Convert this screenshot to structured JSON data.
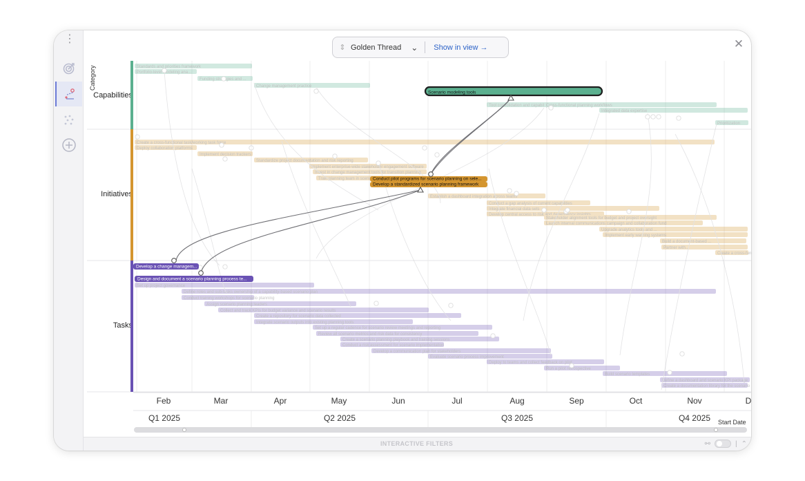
{
  "toolbar": {
    "view_name": "Golden Thread",
    "show_in_view": "Show in view"
  },
  "lanes": {
    "category_header": "Category",
    "capabilities": "Capabilities",
    "initiatives": "Initiatives",
    "tasks": "Tasks"
  },
  "colors": {
    "capabilities": "#5bb08f",
    "initiatives": "#d4952f",
    "tasks": "#6a52b4"
  },
  "axis": {
    "months": [
      "Feb",
      "Mar",
      "Apr",
      "May",
      "Jun",
      "Jul",
      "Aug",
      "Sep",
      "Oct",
      "Nov",
      "D"
    ],
    "quarters": [
      "Q1 2025",
      "Q2 2025",
      "Q3 2025",
      "Q4 2025"
    ],
    "field": "Start Date"
  },
  "highlighted": {
    "capability": "Scenario modeling tools",
    "initiative_1": "Conduct pilot programs for scenario planning on sele...",
    "initiative_2": "Develop a standardized scenario planning framework",
    "task_1": "Develop a change managem...",
    "task_2": "Design and document a scenario planning process te..."
  },
  "faded": {
    "capabilities": [
      "Standards and priorities framework",
      "Portfolio-level modeling ana...",
      "Funding strategies and ...",
      "Change management practice",
      "Tool consolidation and capability libraries",
      "Cross-functional planning workflows",
      "Integrated data expertise",
      "Prioritization"
    ],
    "initiatives": [
      "Create a cross-functional task/working task force",
      "Deploy collaboration platforms",
      "Implement decision trackers",
      "Standardize project documentation and risk reporting",
      "Implement enterprise-wide stakeholder engagement software",
      "Invest in change management tools for transition planning",
      "Train planning team in scenario analysis tools",
      "Establish a dashboard integration across teams",
      "Conduct a gap analysis of current capabilities",
      "Integrate financial data sets",
      "Develop central access to risk and dependency insights",
      "Stakeholder alignment tools for budget and project oversight",
      "Launch internal communications campaign and collaboration fund",
      "Upgrade analytics tools and ...",
      "Implement early warning systems",
      "Build a document-based ...",
      "Partner with..."
    ],
    "tasks": [
      "Set up project governance",
      "Define roles and sub-tasks ownership of a capability-based scenario plan",
      "Conduct training workshops for scenario planning",
      "Assign scenario planning leaders",
      "Collect and track KPIs for budget variance and scenario results",
      "Create a repository for scenario data collected",
      "Integrate scenario outputs into existing planning tools",
      "Set up a regular cadence for scenario review meetings and reporting",
      "Review all scenario metrics and risk data for consistency",
      "Create a scenario planning playbook and training sessions",
      "Conduct a risk assessment for scenario implementation",
      "Develop a communication plan for stakeholders",
      "Evaluate scenario process improvement",
      "Deploy to teams and collect feedback on pilot",
      "Run a pilot retrospective",
      "Build scenario templates",
      "Define a dashboard and scenario KPI package",
      "Create a documentation library for the scenario process"
    ]
  },
  "footer": {
    "filters": "INTERACTIVE FILTERS"
  }
}
